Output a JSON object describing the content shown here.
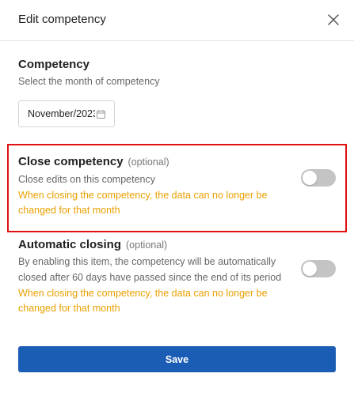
{
  "dialog": {
    "title": "Edit competency",
    "close_icon": "close-icon"
  },
  "competency": {
    "title": "Competency",
    "description": "Select the month of competency",
    "month_value": "November/2023",
    "calendar_icon": "calendar-icon"
  },
  "close_competency": {
    "title": "Close competency",
    "optional": "(optional)",
    "description": "Close edits on this competency",
    "warning_line1": "When closing the competency, the data can no longer be",
    "warning_line2": "changed for that month",
    "toggle_on": false
  },
  "automatic_closing": {
    "title": "Automatic closing",
    "optional": "(optional)",
    "description_line1": "By enabling this item, the competency will be automatically",
    "description_line2": "closed after 60 days have passed since the end of its period",
    "warning_line1": "When closing the competency, the data can no longer be",
    "warning_line2": "changed for that month",
    "toggle_on": false
  },
  "save_label": "Save",
  "colors": {
    "primary": "#1b5db5",
    "warning": "#e8a000",
    "highlight_border": "#e01010",
    "toggle_off": "#c4c4c4"
  }
}
